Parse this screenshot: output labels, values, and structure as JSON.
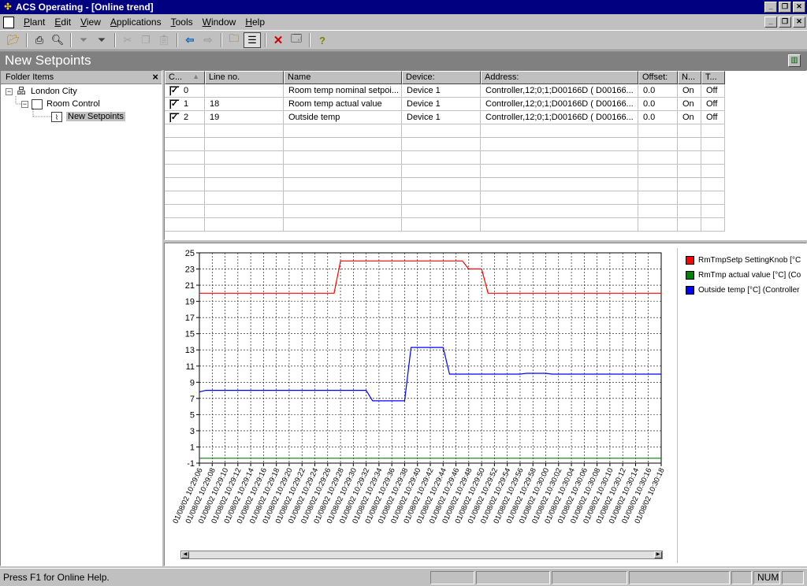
{
  "window": {
    "title": "ACS Operating - [Online trend]"
  },
  "menu": [
    {
      "pre": "",
      "key": "P",
      "post": "lant"
    },
    {
      "pre": "",
      "key": "E",
      "post": "dit"
    },
    {
      "pre": "",
      "key": "V",
      "post": "iew"
    },
    {
      "pre": "",
      "key": "A",
      "post": "pplications"
    },
    {
      "pre": "",
      "key": "T",
      "post": "ools"
    },
    {
      "pre": "",
      "key": "W",
      "post": "indow"
    },
    {
      "pre": "",
      "key": "H",
      "post": "elp"
    }
  ],
  "toolbar": {
    "icons": [
      "open-folder-icon",
      "print-icon",
      "print-preview-icon",
      "filter-icon",
      "filter-plus-icon",
      "cut-icon",
      "copy-icon",
      "paste-icon",
      "back-arrow-icon",
      "forward-arrow-icon",
      "folder-up-icon",
      "list-view-icon",
      "delete-icon",
      "properties-icon",
      "help-icon"
    ]
  },
  "page": {
    "title": "New Setpoints"
  },
  "folder_panel": {
    "header": "Folder Items",
    "tree": [
      "London City",
      "Room Control",
      "New Setpoints"
    ]
  },
  "grid": {
    "columns": [
      "C...",
      "Line no.",
      "Name",
      "Device:",
      "Address:",
      "Offset:",
      "N...",
      "T..."
    ],
    "rows": [
      {
        "c": "0",
        "line": "",
        "name": "Room temp nominal setpoi...",
        "device": "Device 1",
        "address": "Controller,12;0;1;D00166D ( D00166...",
        "offset": "0.0",
        "n": "On",
        "t": "Off"
      },
      {
        "c": "1",
        "line": "18",
        "name": "Room temp actual value",
        "device": "Device 1",
        "address": "Controller,12;0;1;D00166D ( D00166...",
        "offset": "0.0",
        "n": "On",
        "t": "Off"
      },
      {
        "c": "2",
        "line": "19",
        "name": "Outside temp",
        "device": "Device 1",
        "address": "Controller,12;0;1;D00166D ( D00166...",
        "offset": "0.0",
        "n": "On",
        "t": "Off"
      }
    ]
  },
  "chart_data": {
    "type": "line",
    "title": "",
    "xlabel": "",
    "ylabel": "",
    "ylim": [
      -1,
      25
    ],
    "yticks": [
      "25",
      "23",
      "21",
      "19",
      "17",
      "15",
      "13",
      "11",
      "9",
      "7",
      "5",
      "3",
      "1",
      "-1"
    ],
    "grid": true,
    "legend_position": "right",
    "x": [
      "01/08/02 10:29:06",
      "01/08/02 10:29:08",
      "01/08/02 10:29:10",
      "01/08/02 10:29:12",
      "01/08/02 10:29:14",
      "01/08/02 10:29:16",
      "01/08/02 10:29:18",
      "01/08/02 10:29:20",
      "01/08/02 10:29:22",
      "01/08/02 10:29:24",
      "01/08/02 10:29:26",
      "01/08/02 10:29:28",
      "01/08/02 10:29:30",
      "01/08/02 10:29:32",
      "01/08/02 10:29:34",
      "01/08/02 10:29:36",
      "01/08/02 10:29:38",
      "01/08/02 10:29:40",
      "01/08/02 10:29:42",
      "01/08/02 10:29:44",
      "01/08/02 10:29:46",
      "01/08/02 10:29:48",
      "01/08/02 10:29:50",
      "01/08/02 10:29:52",
      "01/08/02 10:29:54",
      "01/08/02 10:29:56",
      "01/08/02 10:29:58",
      "01/08/02 10:30:00",
      "01/08/02 10:30:02",
      "01/08/02 10:30:04",
      "01/08/02 10:30:06",
      "01/08/02 10:30:08",
      "01/08/02 10:30:10",
      "01/08/02 10:30:12",
      "01/08/02 10:30:14",
      "01/08/02 10:30:16",
      "01/08/02 10:30:18"
    ],
    "series": [
      {
        "name": "RmTmpSetp SettingKnob [°C",
        "color": "#ff0000",
        "points": [
          [
            "01/08/02 10:29:06",
            20
          ],
          [
            "01/08/02 10:29:27",
            20
          ],
          [
            "01/08/02 10:29:28",
            24
          ],
          [
            "01/08/02 10:29:47",
            24
          ],
          [
            "01/08/02 10:29:48",
            23
          ],
          [
            "01/08/02 10:29:50",
            23
          ],
          [
            "01/08/02 10:29:51",
            20
          ],
          [
            "01/08/02 10:30:18",
            20
          ]
        ]
      },
      {
        "name": "RmTmp actual value [°C] (Co",
        "color": "#008000",
        "points": [
          [
            "01/08/02 10:29:06",
            -0.4
          ],
          [
            "01/08/02 10:30:18",
            -0.4
          ]
        ]
      },
      {
        "name": "Outside temp [°C] (Controller",
        "color": "#0000ff",
        "points": [
          [
            "01/08/02 10:29:06",
            7.8
          ],
          [
            "01/08/02 10:29:07",
            8
          ],
          [
            "01/08/02 10:29:32",
            8
          ],
          [
            "01/08/02 10:29:33",
            6.7
          ],
          [
            "01/08/02 10:29:38",
            6.7
          ],
          [
            "01/08/02 10:29:39",
            13.3
          ],
          [
            "01/08/02 10:29:44",
            13.3
          ],
          [
            "01/08/02 10:29:45",
            10
          ],
          [
            "01/08/02 10:29:52",
            10
          ],
          [
            "01/08/02 10:29:56",
            10
          ],
          [
            "01/08/02 10:29:57",
            10.1
          ],
          [
            "01/08/02 10:30:00",
            10.1
          ],
          [
            "01/08/02 10:30:01",
            10
          ],
          [
            "01/08/02 10:30:18",
            10
          ]
        ]
      }
    ]
  },
  "statusbar": {
    "help_text": "Press F1 for Online Help.",
    "num": "NUM"
  }
}
